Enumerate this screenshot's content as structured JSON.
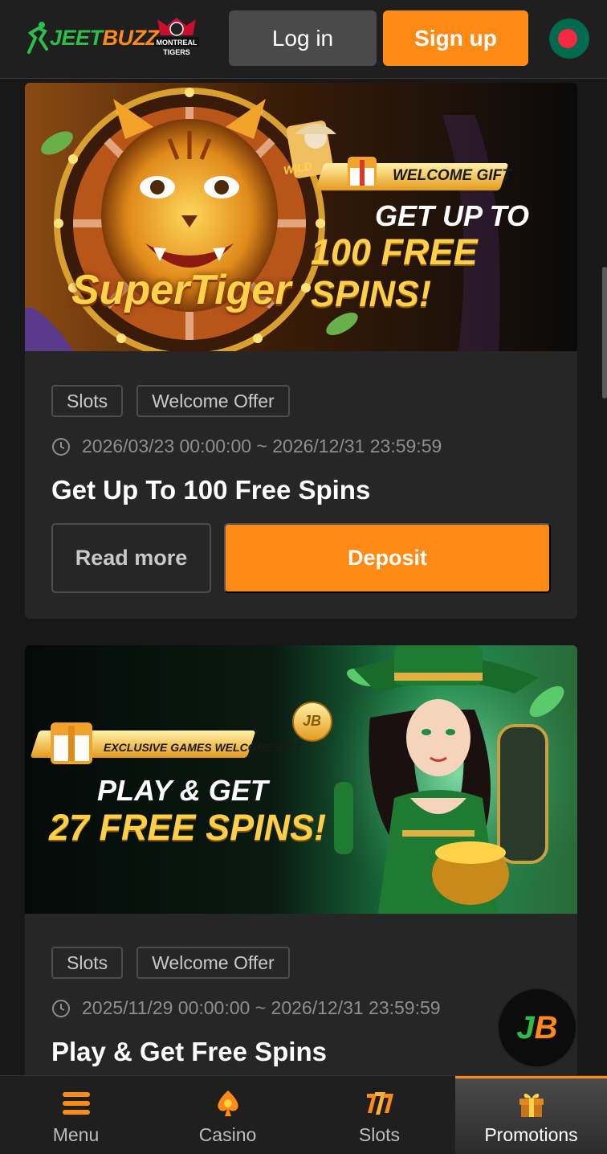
{
  "header": {
    "logo": "JeetBuzz",
    "partner_logo_text": "MONTREAL TIGERS",
    "login_label": "Log in",
    "signup_label": "Sign up",
    "flag_icon": "bangladesh-flag-icon"
  },
  "promotions": [
    {
      "banner": {
        "game_logo": "SuperTiger",
        "wild_badge": "WILD",
        "badge": "WELCOME GIFT",
        "line1": "GET UP TO",
        "line2": "100 FREE SPINS!"
      },
      "tags": [
        "Slots",
        "Welcome Offer"
      ],
      "date_range": "2026/03/23 00:00:00 ~ 2026/12/31 23:59:59",
      "title": "Get Up To 100 Free Spins",
      "read_more_label": "Read more",
      "deposit_label": "Deposit"
    },
    {
      "banner": {
        "badge": "EXCLUSIVE GAMES WELCOME GIFT",
        "line1": "PLAY & GET",
        "line2": "27 FREE SPINS!",
        "coin_text": "JB"
      },
      "tags": [
        "Slots",
        "Welcome Offer"
      ],
      "date_range": "2025/11/29 00:00:00 ~ 2026/12/31 23:59:59",
      "title": "Play & Get Free Spins"
    }
  ],
  "fab_label": "JB",
  "bottom_nav": [
    {
      "label": "Menu",
      "icon": "hamburger-icon",
      "active": false
    },
    {
      "label": "Casino",
      "icon": "spade-icon",
      "active": false
    },
    {
      "label": "Slots",
      "icon": "slots-777-icon",
      "active": false
    },
    {
      "label": "Promotions",
      "icon": "gift-icon",
      "active": true
    }
  ],
  "colors": {
    "accent": "#ff8a15",
    "brand_green": "#2bbf4a",
    "background": "#181818",
    "card": "#262626"
  }
}
